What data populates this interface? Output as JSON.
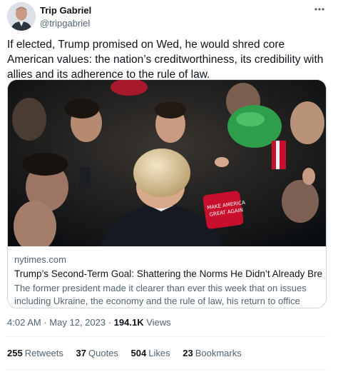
{
  "author": {
    "name": "Trip Gabriel",
    "handle": "@tripgabriel"
  },
  "tweet": {
    "text": "If elected, Trump promised on Wed, he would shred core American values: the nation’s creditworthiness, its credibility with allies and its adherence to the rule of law."
  },
  "card": {
    "domain": "nytimes.com",
    "title": "Trump’s Second-Term Goal: Shattering the Norms He Didn’t Already Break",
    "description": "The former president made it clearer than ever this week that on issues including Ukraine, the economy and the rule of law, his return to office would …",
    "hat_text_1": "MAKE AMERICA",
    "hat_text_2": "GREAT AGAIN"
  },
  "meta": {
    "time": "4:02 AM",
    "separator": "·",
    "date": "May 12, 2023",
    "views_count": "194.1K",
    "views_label": "Views"
  },
  "stats": {
    "retweets_count": "255",
    "retweets_label": "Retweets",
    "quotes_count": "37",
    "quotes_label": "Quotes",
    "likes_count": "504",
    "likes_label": "Likes",
    "bookmarks_count": "23",
    "bookmarks_label": "Bookmarks"
  },
  "icons": {
    "more": "more-icon"
  },
  "colors": {
    "text_primary": "#0f1419",
    "text_secondary": "#536471",
    "border": "#cfd9de",
    "divider": "#eff3f4",
    "hat_red": "#c8102e",
    "hat_green": "#2f9e4a"
  }
}
